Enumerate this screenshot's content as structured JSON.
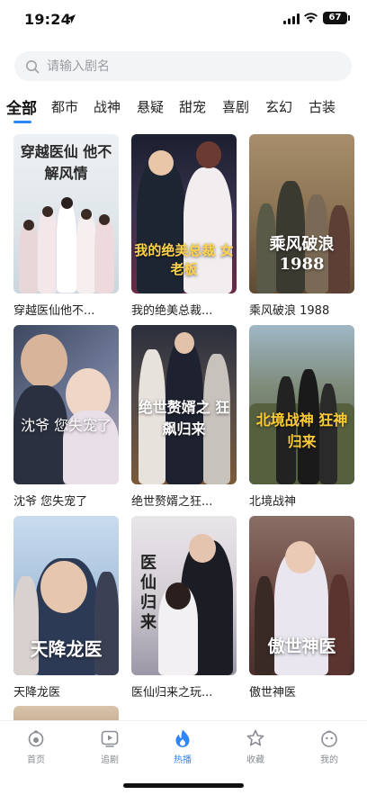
{
  "status_bar": {
    "time": "19:24",
    "battery": "67"
  },
  "search": {
    "placeholder": "请输入剧名"
  },
  "tabs": [
    "全部",
    "都市",
    "战神",
    "悬疑",
    "甜宠",
    "喜剧",
    "玄幻",
    "古装"
  ],
  "active_tab": "全部",
  "dramas": [
    {
      "title": "穿越医仙他不...",
      "poster_text": "穿越医仙 他不解风情"
    },
    {
      "title": "我的绝美总裁...",
      "poster_text": "我的绝美总裁 女老板"
    },
    {
      "title": "乘风破浪 1988",
      "poster_text": "乘风破浪 1988"
    },
    {
      "title": "沈爷 您失宠了",
      "poster_text": "沈爷 您失宠了"
    },
    {
      "title": "绝世赘婿之狂...",
      "poster_text": "绝世赘婿之 狂飙归来"
    },
    {
      "title": "北境战神",
      "poster_text": "北境战神 狂神归来"
    },
    {
      "title": "天降龙医",
      "poster_text": "天降龙医"
    },
    {
      "title": "医仙归来之玩...",
      "poster_text": "医仙归来"
    },
    {
      "title": "傲世神医",
      "poster_text": "傲世神医"
    }
  ],
  "bottom_nav": [
    {
      "label": "首页",
      "icon": "home-icon"
    },
    {
      "label": "追剧",
      "icon": "play-icon"
    },
    {
      "label": "热播",
      "icon": "flame-icon"
    },
    {
      "label": "收藏",
      "icon": "star-icon"
    },
    {
      "label": "我的",
      "icon": "profile-icon"
    }
  ],
  "active_nav": "热播",
  "colors": {
    "accent": "#2f86f6",
    "search_bg": "#f3f4f6",
    "nav_inactive": "#8a8d93"
  }
}
